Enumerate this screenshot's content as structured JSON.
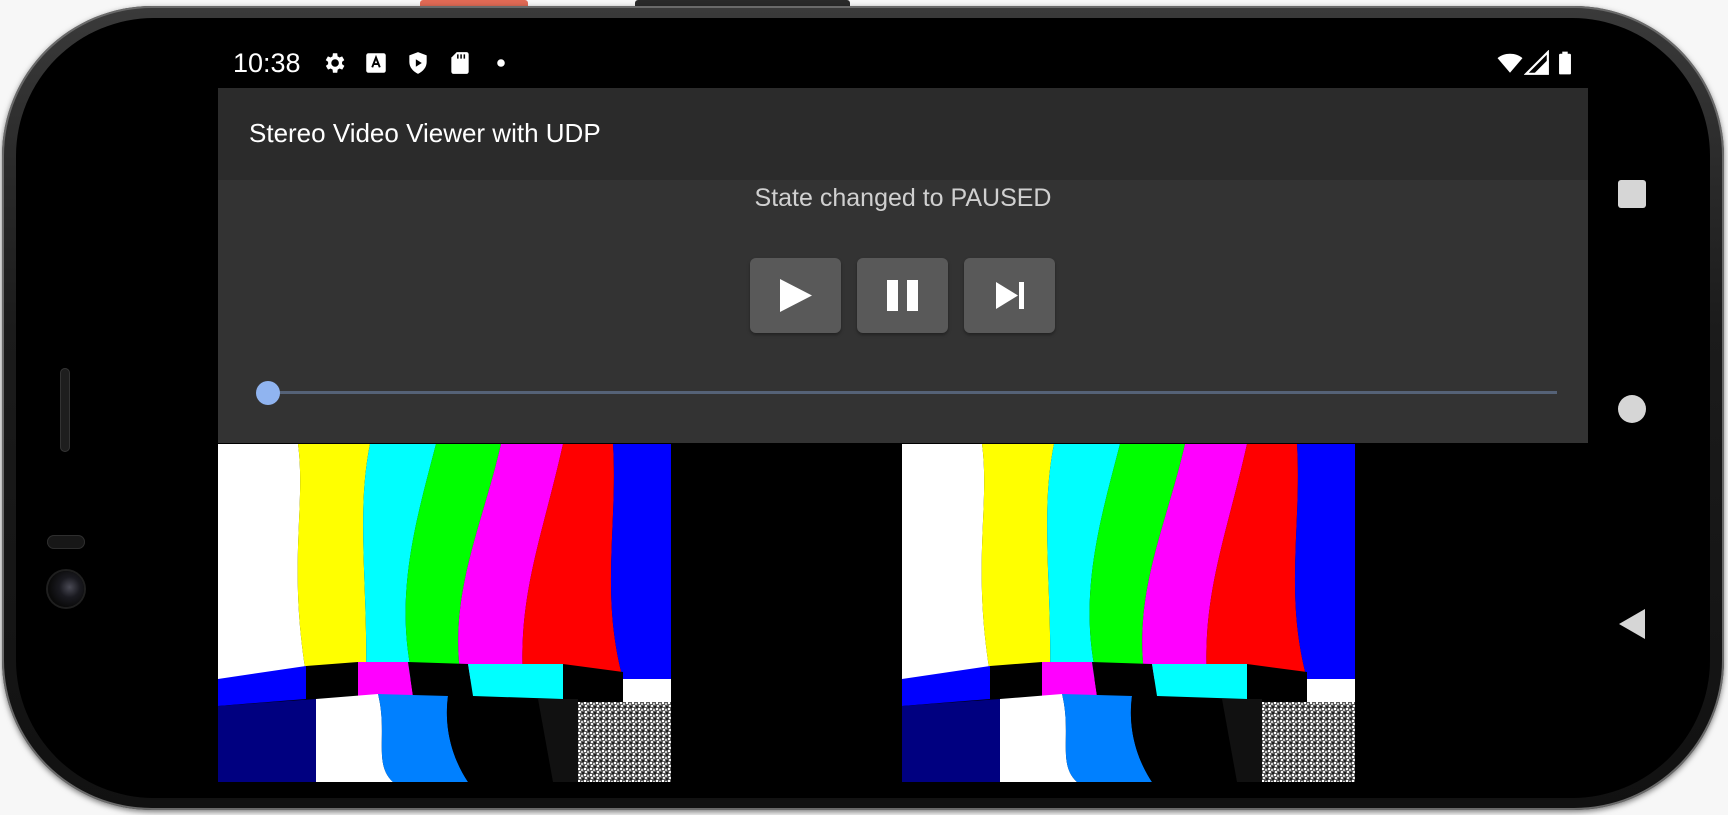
{
  "status_bar": {
    "time": "10:38",
    "left_icons": [
      "settings-icon",
      "text-a-icon",
      "shield-play-icon",
      "sd-card-icon",
      "dot-icon"
    ],
    "right_icons": [
      "wifi-icon",
      "cellular-icon",
      "battery-icon"
    ]
  },
  "app": {
    "title": "Stereo Video Viewer with UDP",
    "state_message": "State changed to PAUSED",
    "controls": [
      {
        "name": "play",
        "icon": "play-icon"
      },
      {
        "name": "pause",
        "icon": "pause-icon"
      },
      {
        "name": "skip",
        "icon": "skip-next-icon"
      }
    ],
    "seek_position": 0.0
  },
  "video": {
    "views": [
      "left-eye",
      "right-eye"
    ],
    "pattern": "smpte-color-bars-distorted"
  },
  "navigation": {
    "buttons": [
      "recents-icon",
      "home-icon",
      "back-icon"
    ]
  },
  "colors": {
    "toolbar": "#2b2b2b",
    "panel": "#333333",
    "button": "#595959",
    "seek_thumb": "#90b4f0",
    "seek_track": "#556277"
  }
}
